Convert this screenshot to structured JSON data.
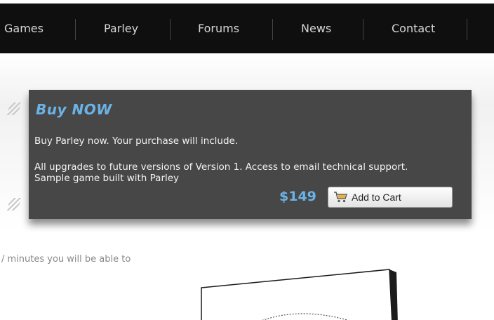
{
  "nav": {
    "items": [
      {
        "label": "Games"
      },
      {
        "label": "Parley"
      },
      {
        "label": "Forums"
      },
      {
        "label": "News"
      },
      {
        "label": "Contact"
      }
    ]
  },
  "buy": {
    "title": "Buy NOW",
    "line1": "Buy Parley now.  Your purchase will include.",
    "line2": "All upgrades to future versions of Version 1. Access to email technical support. Sample game built with Parley",
    "price": "$149",
    "add_to_cart_label": "Add to Cart"
  },
  "content": {
    "intro_fragment": "/ minutes you will be able to"
  },
  "colors": {
    "accent": "#6bb3e6",
    "nav_bg": "#0f0f0f",
    "box_bg": "#474747"
  },
  "icons": {
    "cart": "shopping-cart-icon",
    "hatch": "diagonal-stripes-icon"
  }
}
